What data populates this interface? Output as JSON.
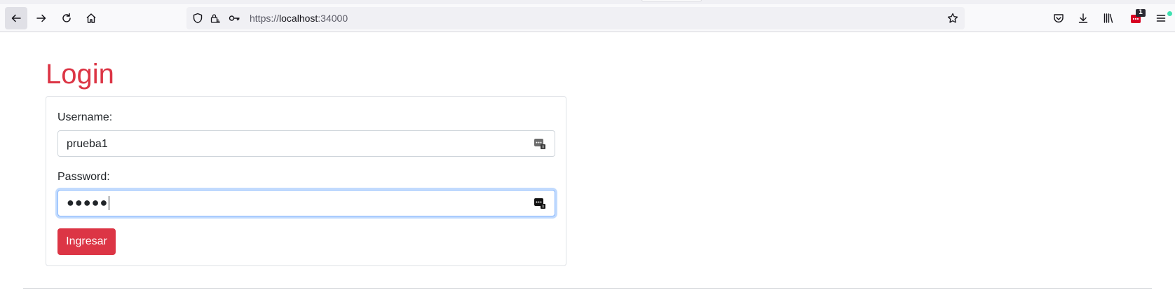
{
  "browser": {
    "url": {
      "scheme": "https://",
      "host": "localhost",
      "port": ":34000"
    },
    "extension_badge": "1",
    "icons": {
      "back": "back-arrow-icon",
      "forward": "forward-arrow-icon",
      "reload": "reload-icon",
      "home": "home-icon",
      "tracking": "shield-icon",
      "connection": "lock-warning-icon",
      "permissions": "key-icon",
      "bookmark": "star-icon",
      "pocket": "pocket-icon",
      "downloads": "download-icon",
      "library": "library-icon",
      "extension": "keepass-extension-icon",
      "menu": "hamburger-menu-icon"
    }
  },
  "page": {
    "title": "Login",
    "form": {
      "username_label": "Username:",
      "username_value": "prueba1",
      "password_label": "Password:",
      "password_masked": "●●●●●",
      "submit_label": "Ingresar"
    }
  },
  "colors": {
    "accent": "#dc3545",
    "focus_ring": "#86b7fe"
  }
}
